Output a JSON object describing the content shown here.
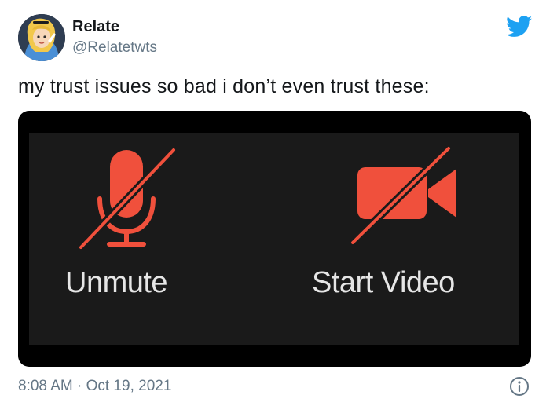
{
  "author": {
    "display_name": "Relate",
    "handle": "@Relatetwts",
    "avatar_icon": "cartoon-girl-avatar"
  },
  "tweet": {
    "text": "my trust issues so bad i don’t even trust these:",
    "timestamp": "8:08 AM · Oct 19, 2021"
  },
  "media": {
    "controls": [
      {
        "label": "Unmute",
        "icon": "muted-microphone-icon"
      },
      {
        "label": "Start Video",
        "icon": "video-off-icon"
      }
    ],
    "icon_color": "#f0503c",
    "background": "#1a1a1a"
  },
  "icons": {
    "brand": "twitter-bird-icon",
    "info": "info-icon"
  },
  "colors": {
    "twitter_blue": "#1da1f2",
    "secondary_text": "#657786"
  }
}
